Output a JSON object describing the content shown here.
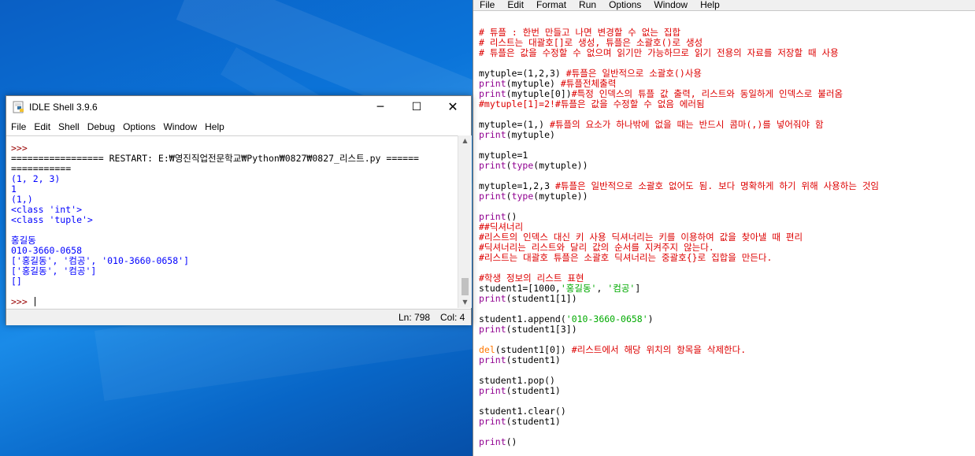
{
  "shell": {
    "title": "IDLE Shell 3.9.6",
    "window_controls": {
      "minimize": "─",
      "maximize": "☐",
      "close": "✕"
    },
    "menu": [
      "File",
      "Edit",
      "Shell",
      "Debug",
      "Options",
      "Window",
      "Help"
    ],
    "output": [
      {
        "text": ">>> ",
        "style": "prompt"
      },
      {
        "text": "================= RESTART: E:₩영진직업전문학교₩Python₩0827₩0827_리스트.py ======",
        "style": "tx"
      },
      {
        "text": "===========",
        "style": "tx"
      },
      {
        "text": "(1, 2, 3)",
        "style": "blue"
      },
      {
        "text": "1",
        "style": "blue"
      },
      {
        "text": "(1,)",
        "style": "blue"
      },
      {
        "text": "<class 'int'>",
        "style": "blue"
      },
      {
        "text": "<class 'tuple'>",
        "style": "blue"
      },
      {
        "text": "",
        "style": "blue"
      },
      {
        "text": "홍길동",
        "style": "blue"
      },
      {
        "text": "010-3660-0658",
        "style": "blue"
      },
      {
        "text": "['홍길동', '컴공', '010-3660-0658']",
        "style": "blue"
      },
      {
        "text": "['홍길동', '컴공']",
        "style": "blue"
      },
      {
        "text": "[]",
        "style": "blue"
      },
      {
        "text": "",
        "style": "blue"
      }
    ],
    "prompt": ">>> ",
    "status": {
      "line": "Ln: 798",
      "col": "Col: 4"
    },
    "scroll_position": 0.9
  },
  "editor": {
    "menu": [
      "File",
      "Edit",
      "Format",
      "Run",
      "Options",
      "Window",
      "Help"
    ],
    "code_lines": [
      [
        [
          "# 튜플 : 한번 만들고 나면 변경할 수 없는 집합",
          "cm"
        ]
      ],
      [
        [
          "# 리스트는 대괄호[]로 생성, 튜플은 소괄호()로 생성",
          "cm"
        ]
      ],
      [
        [
          "# 튜플은 값을 수정할 수 없으며 읽기만 가능하므로 읽기 전용의 자료를 저장할 때 사용",
          "cm"
        ]
      ],
      [],
      [
        [
          "mytuple=(1,2,3) ",
          "tx"
        ],
        [
          "#튜플은 일반적으로 소괄호()사용",
          "cm"
        ]
      ],
      [
        [
          "print",
          "bi"
        ],
        [
          "(mytuple) ",
          "tx"
        ],
        [
          "#튜플전체출력",
          "cm"
        ]
      ],
      [
        [
          "print",
          "bi"
        ],
        [
          "(mytuple[0])",
          "tx"
        ],
        [
          "#특정 인덱스의 튜플 값 출력, 리스트와 동일하게 인덱스로 불러옴",
          "cm"
        ]
      ],
      [
        [
          "#mytuple[1]=2!#튜플은 값을 수정할 수 없음 에러됨",
          "cm"
        ]
      ],
      [],
      [
        [
          "mytuple=(1,) ",
          "tx"
        ],
        [
          "#튜플의 요소가 하나밖에 없을 때는 반드시 콤마(,)를 넣어줘야 함",
          "cm"
        ]
      ],
      [
        [
          "print",
          "bi"
        ],
        [
          "(mytuple)",
          "tx"
        ]
      ],
      [],
      [
        [
          "mytuple=1",
          "tx"
        ]
      ],
      [
        [
          "print",
          "bi"
        ],
        [
          "(",
          "tx"
        ],
        [
          "type",
          "bi"
        ],
        [
          "(mytuple))",
          "tx"
        ]
      ],
      [],
      [
        [
          "mytuple=1,2,3 ",
          "tx"
        ],
        [
          "#튜플은 일반적으로 소괄호 없어도 됨. 보다 명확하게 하기 위해 사용하는 것임",
          "cm"
        ]
      ],
      [
        [
          "print",
          "bi"
        ],
        [
          "(",
          "tx"
        ],
        [
          "type",
          "bi"
        ],
        [
          "(mytuple))",
          "tx"
        ]
      ],
      [],
      [
        [
          "print",
          "bi"
        ],
        [
          "()",
          "tx"
        ]
      ],
      [
        [
          "##딕셔너리",
          "cm"
        ]
      ],
      [
        [
          "#리스트의 인덱스 대신 키 사용 딕셔너리는 키를 이용하여 값을 찾아낼 때 편리",
          "cm"
        ]
      ],
      [
        [
          "#딕셔너리는 리스트와 달리 값의 순서를 지켜주지 않는다.",
          "cm"
        ]
      ],
      [
        [
          "#리스트는 대괄호 튜플은 소괄호 딕셔너리는 중괄호{}로 집합을 만든다.",
          "cm"
        ]
      ],
      [],
      [
        [
          "#학생 정보의 리스트 표현",
          "cm"
        ]
      ],
      [
        [
          "student1=[1000,",
          "tx"
        ],
        [
          "'홍길동'",
          "st"
        ],
        [
          ", ",
          "tx"
        ],
        [
          "'컴공'",
          "st"
        ],
        [
          "]",
          "tx"
        ]
      ],
      [
        [
          "print",
          "bi"
        ],
        [
          "(student1[1])",
          "tx"
        ]
      ],
      [],
      [
        [
          "student1.append(",
          "tx"
        ],
        [
          "'010-3660-0658'",
          "st"
        ],
        [
          ")",
          "tx"
        ]
      ],
      [
        [
          "print",
          "bi"
        ],
        [
          "(student1[3])",
          "tx"
        ]
      ],
      [],
      [
        [
          "del",
          "kw"
        ],
        [
          "(student1[0]) ",
          "tx"
        ],
        [
          "#리스트에서 해당 위치의 항목을 삭제한다.",
          "cm"
        ]
      ],
      [
        [
          "print",
          "bi"
        ],
        [
          "(student1)",
          "tx"
        ]
      ],
      [],
      [
        [
          "student1.pop()",
          "tx"
        ]
      ],
      [
        [
          "print",
          "bi"
        ],
        [
          "(student1)",
          "tx"
        ]
      ],
      [],
      [
        [
          "student1.clear()",
          "tx"
        ]
      ],
      [
        [
          "print",
          "bi"
        ],
        [
          "(student1)",
          "tx"
        ]
      ],
      [],
      [
        [
          "print",
          "bi"
        ],
        [
          "()",
          "tx"
        ]
      ]
    ]
  }
}
